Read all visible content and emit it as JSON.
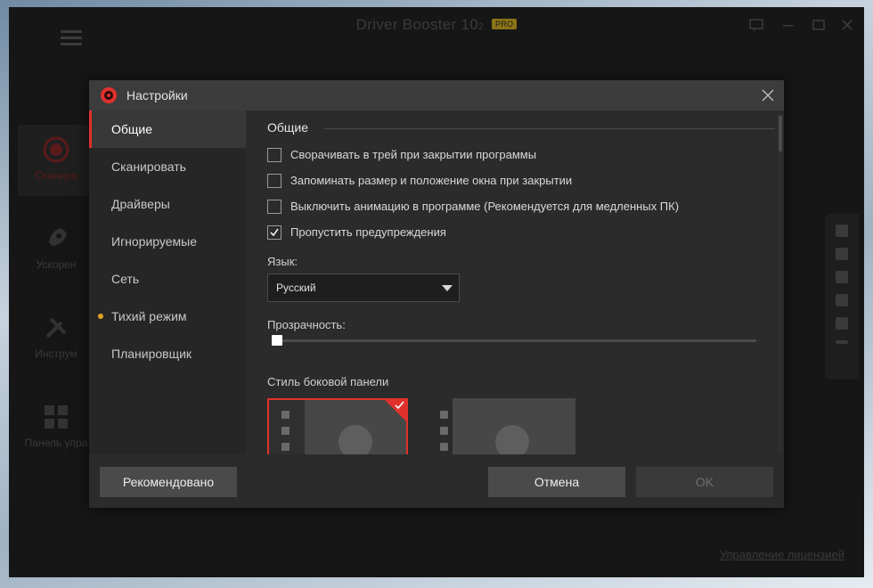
{
  "app": {
    "title": "Driver Booster 10",
    "version_suffix": "2",
    "badge": "PRO",
    "nav": [
      {
        "label": "Сканиро",
        "icon": "scan-icon"
      },
      {
        "label": "Ускорен",
        "icon": "rocket-icon"
      },
      {
        "label": "Инструм",
        "icon": "tools-icon"
      },
      {
        "label": "Панель упра",
        "icon": "grid-icon"
      }
    ],
    "license_link": "Управление лицензией"
  },
  "dialog": {
    "title": "Настройки",
    "sidebar": [
      {
        "label": "Общие"
      },
      {
        "label": "Сканировать"
      },
      {
        "label": "Драйверы"
      },
      {
        "label": "Игнорируемые"
      },
      {
        "label": "Сеть"
      },
      {
        "label": "Тихий режим"
      },
      {
        "label": "Планировщик"
      }
    ],
    "section_title": "Общие",
    "checkboxes": [
      {
        "label": "Сворачивать в трей при закрытии программы",
        "checked": false
      },
      {
        "label": "Запоминать размер и положение окна при закрытии",
        "checked": false
      },
      {
        "label": "Выключить анимацию в программе (Рекомендуется для медленных ПК)",
        "checked": false
      },
      {
        "label": "Пропустить предупреждения",
        "checked": true
      }
    ],
    "language_label": "Язык:",
    "language_value": "Русский",
    "transparency_label": "Прозрачность:",
    "transparency_value": 0,
    "sidebar_style_label": "Стиль боковой панели",
    "sidebar_style_selected": 1,
    "buttons": {
      "recommended": "Рекомендовано",
      "cancel": "Отмена",
      "ok": "OK"
    }
  },
  "colors": {
    "accent": "#e0312d",
    "quiet_mode_dot": "#e0a320"
  }
}
